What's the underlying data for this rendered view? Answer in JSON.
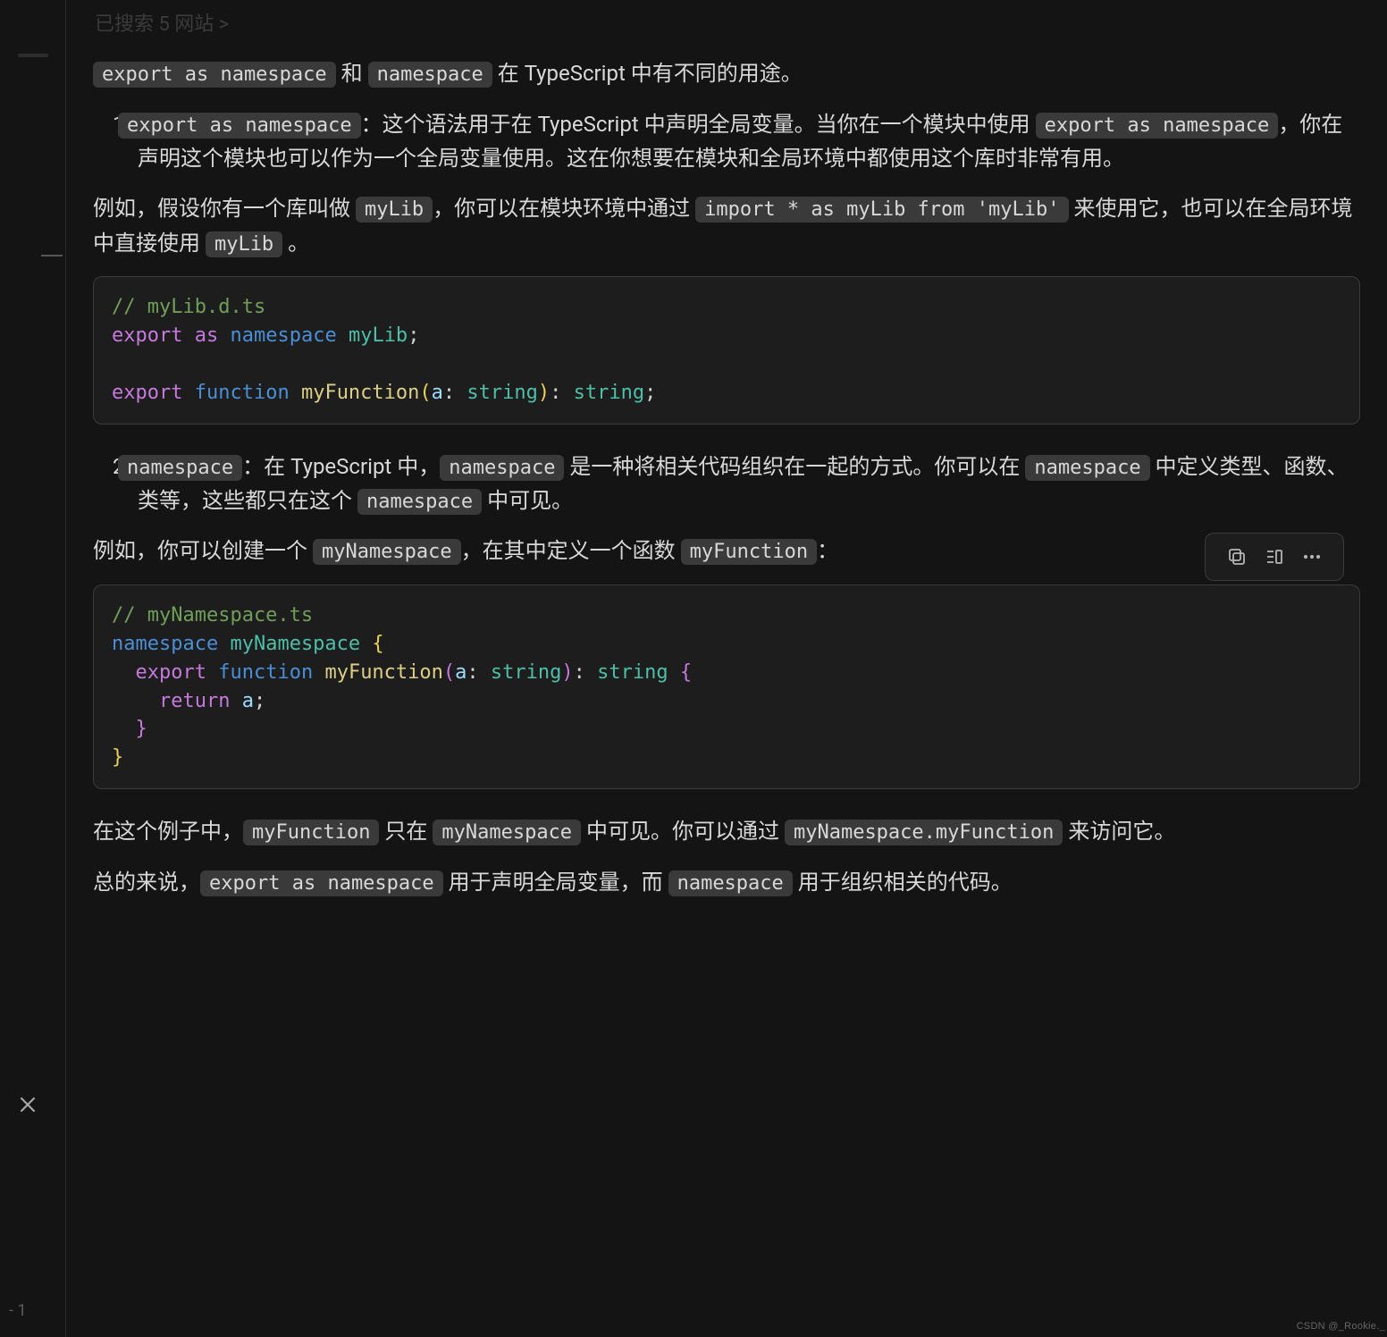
{
  "top_faded": "已搜索 5 网站 >",
  "intro_pre": " 和 ",
  "intro_c1": "export as namespace",
  "intro_c2": "namespace",
  "intro_post": " 在 TypeScript 中有不同的用途。",
  "li1_num": "1.",
  "li1_c1": "export as namespace",
  "li1_t1": "：这个语法用于在 TypeScript 中声明全局变量。当你在一个模块中使用 ",
  "li1_c2": "export as namespace",
  "li1_t2": "，你在声明这个模块也可以作为一个全局变量使用。这在你想要在模块和全局环境中都使用这个库时非常有用。",
  "p1_t1": "例如，假设你有一个库叫做 ",
  "p1_c1": "myLib",
  "p1_t2": "，你可以在模块环境中通过 ",
  "p1_c2": "import * as myLib from 'myLib'",
  "p1_t3": " 来使用它，也可以在全局环境中直接使用 ",
  "p1_c3": "myLib",
  "p1_t4": " 。",
  "code1": {
    "c1": "// myLib.d.ts",
    "l2a": "export",
    "l2b": "as",
    "l2c": "namespace",
    "l2d": "myLib",
    "l2e": ";",
    "l3a": "export",
    "l3b": "function",
    "l3c": "myFunction",
    "l3d": "(",
    "l3e": "a",
    "l3f": ": ",
    "l3g": "string",
    "l3h": ")",
    "l3i": ": ",
    "l3j": "string",
    "l3k": ";"
  },
  "li2_num": "2.",
  "li2_c1": "namespace",
  "li2_t1": "：在 TypeScript 中，",
  "li2_c2": "namespace",
  "li2_t2": " 是一种将相关代码组织在一起的方式。你可以在 ",
  "li2_c3": "namespace",
  "li2_t3": " 中定义类型、函数、类等，这些都只在这个 ",
  "li2_c4": "namespace",
  "li2_t4": " 中可见。",
  "p2_t1": "例如，你可以创建一个 ",
  "p2_c1": "myNamespace",
  "p2_t2": "，在其中定义一个函数 ",
  "p2_c2": "myFunction",
  "p2_t3": "：",
  "code2": {
    "c1": "// myNamespace.ts",
    "l2a": "namespace",
    "l2b": "myNamespace",
    "l2c": "{",
    "l3a": "export",
    "l3b": "function",
    "l3c": "myFunction",
    "l3d": "(",
    "l3e": "a",
    "l3f": ": ",
    "l3g": "string",
    "l3h": ")",
    "l3i": ": ",
    "l3j": "string",
    "l3k": "{",
    "l4a": "return",
    "l4b": "a",
    "l4c": ";",
    "l5a": "}",
    "l6a": "}"
  },
  "p3_t1": "在这个例子中，",
  "p3_c1": "myFunction",
  "p3_t2": " 只在 ",
  "p3_c2": "myNamespace",
  "p3_t3": " 中可见。你可以通过 ",
  "p3_c3": "myNamespace.myFunction",
  "p3_t4": " 来访问它。",
  "p4_t1": "总的来说，",
  "p4_c1": "export as namespace",
  "p4_t2": " 用于声明全局变量，而 ",
  "p4_c2": "namespace",
  "p4_t3": " 用于组织相关的代码。",
  "toolbar_icons": {
    "copy": "copy-icon",
    "insert": "insert-at-cursor-icon",
    "more": "more-icon"
  },
  "watermark": "CSDN @_Rookie._",
  "gutter_close": "✕",
  "gutter_bottom": "- 1"
}
